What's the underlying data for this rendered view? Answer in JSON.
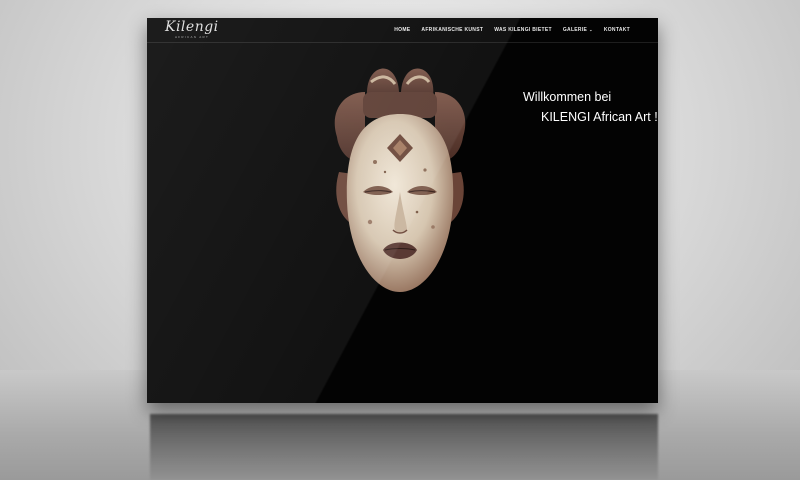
{
  "logo": {
    "name": "Kilengi",
    "tagline": "African Art"
  },
  "nav": {
    "items": [
      {
        "label": "HOME"
      },
      {
        "label": "AFRIKANISCHE KUNST"
      },
      {
        "label": "WAS KILENGI BIETET"
      },
      {
        "label": "GALERIE"
      },
      {
        "label": "KONTAKT"
      }
    ]
  },
  "hero": {
    "line1": "Willkommen bei",
    "line2": "KILENGI African Art !",
    "image": "punu-mask-image"
  },
  "colors": {
    "background": "#030303",
    "text": "#ffffff",
    "stage": "#d6d6d6"
  }
}
